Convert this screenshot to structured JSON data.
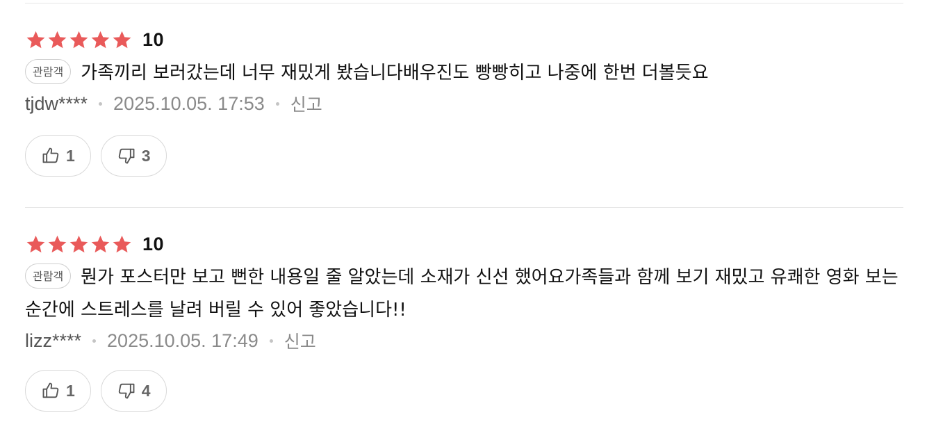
{
  "colors": {
    "star": "#e95a5a",
    "divider": "#e6e6e6",
    "meta": "#8a8a8a"
  },
  "reviews": [
    {
      "rating_value": 5,
      "score": "10",
      "badge": "관람객",
      "text": "가족끼리 보러갔는데 너무 재밌게 봤습니다배우진도 빵빵히고 나중에 한번 더볼듯요",
      "user": "tjdw****",
      "date": "2025.10.05. 17:53",
      "report": "신고",
      "likes": "1",
      "dislikes": "3"
    },
    {
      "rating_value": 5,
      "score": "10",
      "badge": "관람객",
      "text": "뭔가 포스터만 보고 뻔한 내용일 줄 알았는데 소재가 신선 했어요가족들과 함께 보기 재밌고 유쾌한 영화 보는 순간에 스트레스를 날려 버릴 수 있어 좋았습니다!!",
      "user": "lizz****",
      "date": "2025.10.05. 17:49",
      "report": "신고",
      "likes": "1",
      "dislikes": "4"
    }
  ]
}
